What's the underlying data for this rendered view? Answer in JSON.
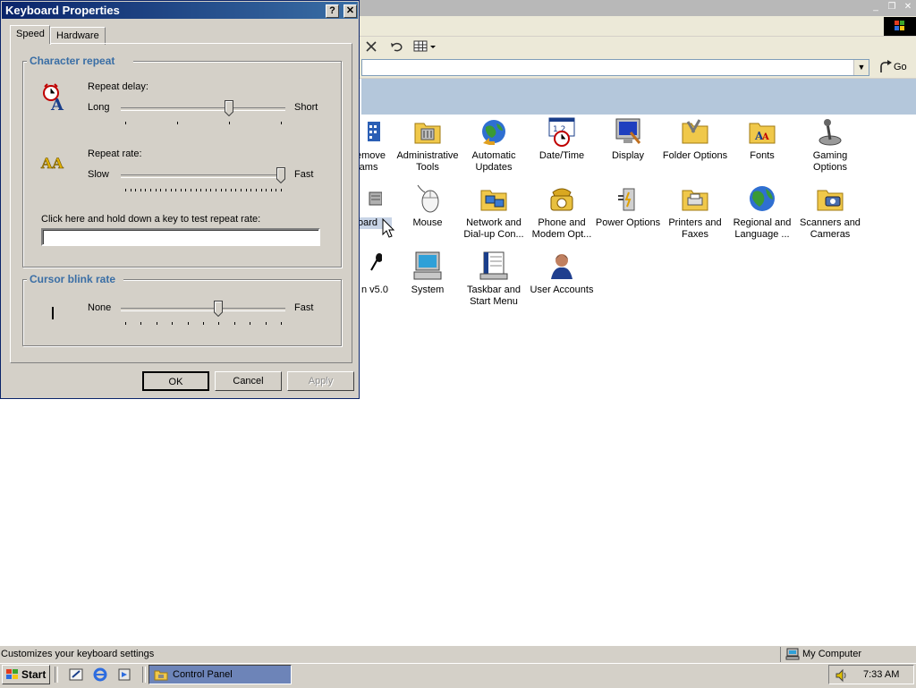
{
  "dialog": {
    "title": "Keyboard Properties",
    "help_glyph": "?",
    "close_glyph": "✕",
    "tabs": [
      {
        "label": "Speed",
        "selected": true
      },
      {
        "label": "Hardware",
        "selected": false
      }
    ],
    "character_repeat": {
      "title": "Character repeat",
      "repeat_delay": {
        "label": "Repeat delay:",
        "min_label": "Long",
        "max_label": "Short",
        "value": 2,
        "max": 3
      },
      "repeat_rate": {
        "label": "Repeat rate:",
        "min_label": "Slow",
        "max_label": "Fast",
        "value": 31,
        "max": 31
      },
      "test_label": "Click here and hold down a key to test repeat rate:",
      "test_value": ""
    },
    "cursor_blink": {
      "title": "Cursor blink rate",
      "min_label": "None",
      "max_label": "Fast",
      "value": 6,
      "max": 10
    },
    "buttons": {
      "ok": "OK",
      "cancel": "Cancel",
      "apply": "Apply"
    }
  },
  "explorer": {
    "go_label": "Go",
    "address_value": "",
    "items_row1": [
      {
        "label": "emove\nrams",
        "icon": "add-remove-programs-icon"
      },
      {
        "label": "Administrative\nTools",
        "icon": "administrative-tools-icon"
      },
      {
        "label": "Automatic\nUpdates",
        "icon": "automatic-updates-icon"
      },
      {
        "label": "Date/Time",
        "icon": "date-time-icon"
      },
      {
        "label": "Display",
        "icon": "display-icon"
      },
      {
        "label": "Folder Options",
        "icon": "folder-options-icon"
      },
      {
        "label": "Fonts",
        "icon": "fonts-icon"
      },
      {
        "label": "Gaming\nOptions",
        "icon": "gaming-options-icon"
      }
    ],
    "items_row2": [
      {
        "label": "oard",
        "icon": "keyboard-icon"
      },
      {
        "label": "Mouse",
        "icon": "mouse-icon"
      },
      {
        "label": "Network and\nDial-up Con...",
        "icon": "network-icon"
      },
      {
        "label": "Phone and\nModem Opt...",
        "icon": "phone-modem-icon"
      },
      {
        "label": "Power Options",
        "icon": "power-options-icon"
      },
      {
        "label": "Printers and\nFaxes",
        "icon": "printers-faxes-icon"
      },
      {
        "label": "Regional and\nLanguage ...",
        "icon": "regional-language-icon"
      },
      {
        "label": "Scanners and\nCameras",
        "icon": "scanners-cameras-icon"
      }
    ],
    "items_row3": [
      {
        "label": "n v5.0",
        "icon": "speech-icon"
      },
      {
        "label": "System",
        "icon": "system-icon"
      },
      {
        "label": "Taskbar and\nStart Menu",
        "icon": "taskbar-start-menu-icon"
      },
      {
        "label": "User Accounts",
        "icon": "user-accounts-icon"
      }
    ]
  },
  "statusbar": {
    "text": "Customizes your keyboard settings",
    "zone": "My Computer"
  },
  "taskbar": {
    "start_label": "Start",
    "task_label": "Control Panel",
    "clock": "7:33 AM"
  }
}
